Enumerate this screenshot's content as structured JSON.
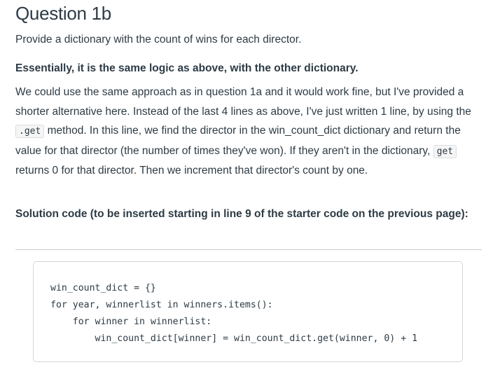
{
  "heading": "Question 1b",
  "intro": "Provide a dictionary with the count of wins for each director.",
  "emphasis": "Essentially, it is the same logic as above, with the other dictionary.",
  "explanation": {
    "part1": "We could use the same approach as in question 1a and it would work fine, but I've provided a shorter alternative here. Instead of the last 4 lines as above, I've just written 1 line, by using the ",
    "code1": ".get",
    "part2": " method. In this line, we find the director in the win_count_dict dictionary and return the value for that director (the number of times they've won). If they aren't in the dictionary, ",
    "code2": "get",
    "part3": " returns 0 for that director. Then we increment that director's count by one."
  },
  "solution_label": "Solution code (to be inserted starting in line 9 of the starter code on the previous page):",
  "code_lines": [
    "win_count_dict = {}",
    "for year, winnerlist in winners.items():",
    "    for winner in winnerlist:",
    "        win_count_dict[winner] = win_count_dict.get(winner, 0) + 1"
  ]
}
